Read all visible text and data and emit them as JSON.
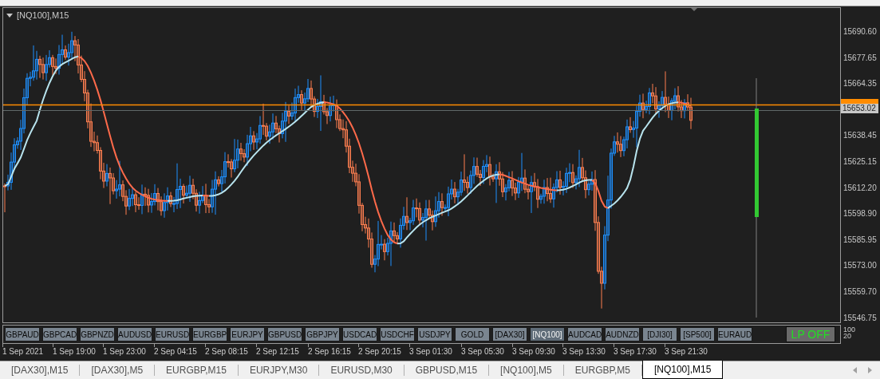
{
  "chart": {
    "title": "[NQ100],M15",
    "price_ticks": [
      "15690.60",
      "15677.65",
      "15664.35",
      "15638.45",
      "15625.15",
      "15612.20",
      "15598.90",
      "15585.95",
      "15573.00",
      "15559.70",
      "15546.75"
    ],
    "bid_label": "15653.02",
    "time_labels": [
      "1 Sep 2021",
      "1 Sep 19:00",
      "1 Sep 23:00",
      "2 Sep 04:15",
      "2 Sep 08:15",
      "2 Sep 12:15",
      "2 Sep 16:15",
      "2 Sep 20:15",
      "3 Sep 01:30",
      "3 Sep 05:30",
      "3 Sep 09:30",
      "3 Sep 13:30",
      "3 Sep 17:30",
      "3 Sep 21:30"
    ]
  },
  "symbol_buttons": [
    {
      "label": "GBPAUD",
      "selected": false
    },
    {
      "label": "GBPCAD",
      "selected": false
    },
    {
      "label": "GBPNZD",
      "selected": false
    },
    {
      "label": "AUDUSD",
      "selected": false
    },
    {
      "label": "EURUSD",
      "selected": false
    },
    {
      "label": "EURGBP",
      "selected": false
    },
    {
      "label": "EURJPY",
      "selected": false
    },
    {
      "label": "GBPUSD",
      "selected": false
    },
    {
      "label": "GBPJPY",
      "selected": false
    },
    {
      "label": "USDCAD",
      "selected": false
    },
    {
      "label": "USDCHF",
      "selected": false
    },
    {
      "label": "USDJPY",
      "selected": false
    },
    {
      "label": "GOLD",
      "selected": false
    },
    {
      "label": "[DAX30]",
      "selected": false
    },
    {
      "label": "[NQ100]",
      "selected": true
    },
    {
      "label": "AUDCAD",
      "selected": false
    },
    {
      "label": "AUDNZD",
      "selected": false
    },
    {
      "label": "[DJI30]",
      "selected": false
    },
    {
      "label": "[SP500]",
      "selected": false
    },
    {
      "label": "EURAUD",
      "selected": false
    }
  ],
  "lp_button": {
    "label": "LP OFF"
  },
  "scale_labels": [
    "100",
    "20"
  ],
  "tabs": [
    {
      "label": "[DAX30],M15",
      "selected": false
    },
    {
      "label": "[DAX30],M5",
      "selected": false
    },
    {
      "label": "EURGBP,M15",
      "selected": false
    },
    {
      "label": "EURJPY,M30",
      "selected": false
    },
    {
      "label": "EURUSD,M30",
      "selected": false
    },
    {
      "label": "GBPUSD,M15",
      "selected": false
    },
    {
      "label": "[NQ100],M5",
      "selected": false
    },
    {
      "label": "EURGBP,M5",
      "selected": false
    },
    {
      "label": "[NQ100],M15",
      "selected": true
    }
  ]
}
